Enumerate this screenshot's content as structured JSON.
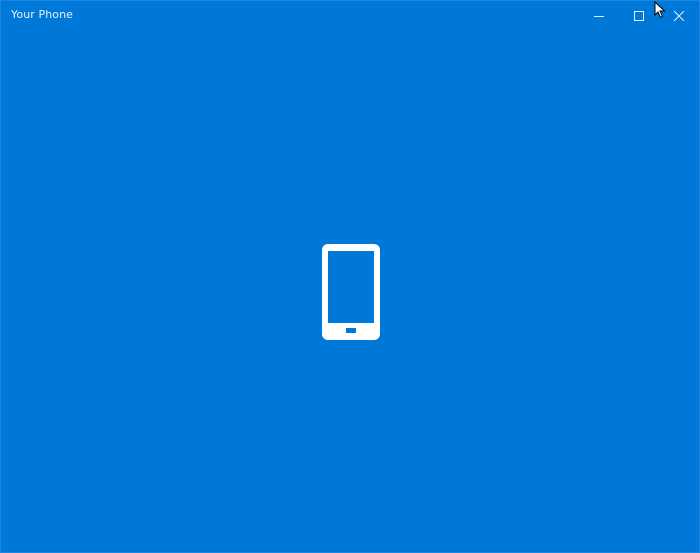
{
  "window": {
    "title": "Your Phone",
    "background_color": "#0078d7"
  },
  "caption_buttons": {
    "minimize_icon": "minimize-icon",
    "maximize_icon": "maximize-icon",
    "close_icon": "close-icon"
  },
  "splash": {
    "icon": "phone-icon"
  },
  "cursor": {
    "icon": "mouse-pointer-icon"
  }
}
